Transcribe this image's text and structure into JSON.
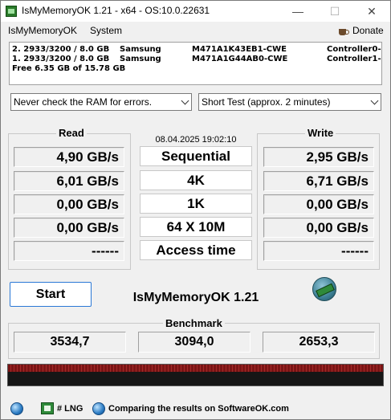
{
  "window": {
    "title": "IsMyMemoryOK 1.21 - x64 - OS:10.0.22631",
    "minimize_glyph": "—",
    "maximize_glyph": "☐",
    "close_glyph": "✕"
  },
  "menu": {
    "app_label": "IsMyMemoryOK",
    "system_label": "System",
    "donate_label": "Donate",
    "donate_icon": "coffee-cup-icon"
  },
  "memory_info": {
    "modules": [
      {
        "spec": "2. 2933/3200 / 8.0 GB",
        "brand": "Samsung",
        "part": "M471A1K43EB1-CWE",
        "controller": "Controller0-"
      },
      {
        "spec": "1. 2933/3200 / 8.0 GB",
        "brand": "Samsung",
        "part": "M471A1G44AB0-CWE",
        "controller": "Controller1-"
      }
    ],
    "free_text": "Free 6.35 GB of 15.78 GB"
  },
  "options": {
    "error_check_selected": "Never check the RAM for errors.",
    "test_length_selected": "Short Test (approx. 2 minutes)"
  },
  "read": {
    "label": "Read",
    "values": [
      "4,90 GB/s",
      "6,01 GB/s",
      "0,00 GB/s",
      "0,00 GB/s",
      "------"
    ]
  },
  "write": {
    "label": "Write",
    "values": [
      "2,95 GB/s",
      "6,71 GB/s",
      "0,00 GB/s",
      "0,00 GB/s",
      "------"
    ]
  },
  "tests": {
    "datetime": "08.04.2025 19:02:10",
    "labels": [
      "Sequential",
      "4K",
      "1K",
      "64 X 10M",
      "Access time"
    ]
  },
  "actions": {
    "start_label": "Start",
    "app_name": "IsMyMemoryOK 1.21"
  },
  "benchmark": {
    "label": "Benchmark",
    "values": [
      "3534,7",
      "3094,0",
      "2653,3"
    ]
  },
  "status_bar": {
    "language_label": "# LNG",
    "compare_text": "Comparing the results on SoftwareOK.com"
  }
}
